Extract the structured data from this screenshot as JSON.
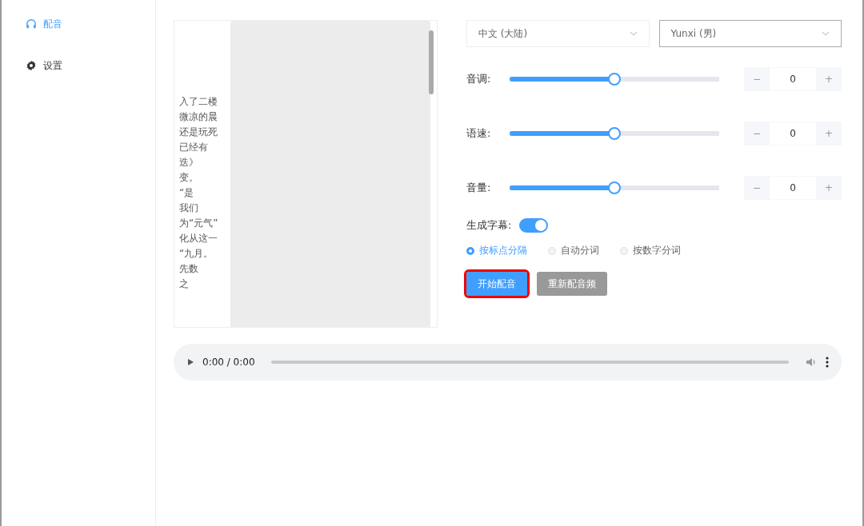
{
  "sidebar": {
    "items": [
      {
        "label": "配音",
        "selected": true
      },
      {
        "label": "设置",
        "selected": false
      }
    ]
  },
  "text_area": {
    "lines": [
      "入了二楼",
      "微凉的晨",
      "还是玩死",
      "已经有",
      "迭》",
      "变。",
      "“是",
      "我们",
      "为“元气”",
      "化从这一",
      "“九月。",
      "先数",
      "之"
    ]
  },
  "selects": [
    {
      "value": "中文 (大陆)",
      "focused": false
    },
    {
      "value": "Yunxi (男)",
      "focused": true
    }
  ],
  "sliders": [
    {
      "label": "音调:",
      "level": 0.5,
      "minus": "−",
      "value": "0",
      "plus": "+"
    },
    {
      "label": "语速:",
      "level": 0.5,
      "minus": "−",
      "value": "0",
      "plus": "+"
    },
    {
      "label": "音量:",
      "level": 0.5,
      "minus": "−",
      "value": "0",
      "plus": "+"
    }
  ],
  "subtitle": {
    "label": "生成字幕:",
    "on": true
  },
  "split_options": [
    {
      "label": "按标点分隔",
      "selected": true
    },
    {
      "label": "自动分词",
      "selected": false
    },
    {
      "label": "按数字分词",
      "selected": false
    }
  ],
  "buttons": [
    {
      "label": "开始配音",
      "kind": "primary",
      "highlighted": true
    },
    {
      "label": "重新配音频",
      "kind": "disabled",
      "highlighted": false
    }
  ],
  "audio_player": {
    "time": "0:00 / 0:00",
    "level": 0
  }
}
